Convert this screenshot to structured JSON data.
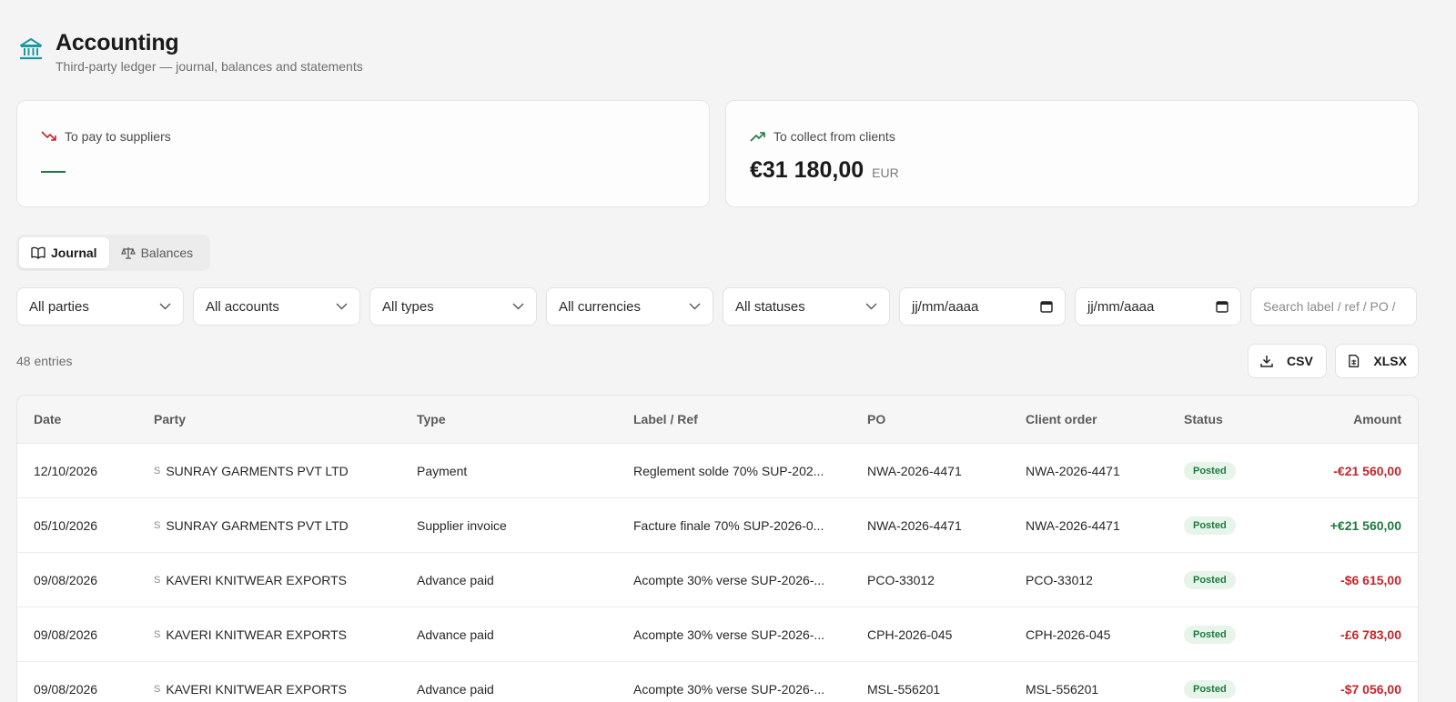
{
  "header": {
    "title": "Accounting",
    "subtitle": "Third-party ledger — journal, balances and statements"
  },
  "cards": {
    "pay": {
      "label": "To pay to suppliers",
      "value": ""
    },
    "collect": {
      "label": "To collect from clients",
      "amount": "€31 180,00",
      "currency": "EUR"
    }
  },
  "tabs": [
    {
      "label": "Journal",
      "active": true
    },
    {
      "label": "Balances",
      "active": false
    }
  ],
  "filters": {
    "parties": "All parties",
    "accounts": "All accounts",
    "types": "All types",
    "currencies": "All currencies",
    "statuses": "All statuses",
    "date_from": "jj/mm/aaaa",
    "date_to": "jj/mm/aaaa",
    "search_placeholder": "Search label / ref / PO /"
  },
  "entries_count": "48 entries",
  "export": {
    "csv": "CSV",
    "xlsx": "XLSX"
  },
  "table": {
    "headers": {
      "date": "Date",
      "party": "Party",
      "type": "Type",
      "label": "Label / Ref",
      "po": "PO",
      "client_order": "Client order",
      "status": "Status",
      "amount": "Amount"
    },
    "rows": [
      {
        "date": "12/10/2026",
        "party_prefix": "S",
        "party": "SUNRAY GARMENTS PVT LTD",
        "type": "Payment",
        "label": "Reglement solde 70% SUP-202...",
        "po": "NWA-2026-4471",
        "client_order": "NWA-2026-4471",
        "status": "Posted",
        "amount": "-€21 560,00"
      },
      {
        "date": "05/10/2026",
        "party_prefix": "S",
        "party": "SUNRAY GARMENTS PVT LTD",
        "type": "Supplier invoice",
        "label": "Facture finale 70% SUP-2026-0...",
        "po": "NWA-2026-4471",
        "client_order": "NWA-2026-4471",
        "status": "Posted",
        "amount": "+€21 560,00"
      },
      {
        "date": "09/08/2026",
        "party_prefix": "S",
        "party": "KAVERI KNITWEAR EXPORTS",
        "type": "Advance paid",
        "label": "Acompte 30% verse SUP-2026-...",
        "po": "PCO-33012",
        "client_order": "PCO-33012",
        "status": "Posted",
        "amount": "-$6 615,00"
      },
      {
        "date": "09/08/2026",
        "party_prefix": "S",
        "party": "KAVERI KNITWEAR EXPORTS",
        "type": "Advance paid",
        "label": "Acompte 30% verse SUP-2026-...",
        "po": "CPH-2026-045",
        "client_order": "CPH-2026-045",
        "status": "Posted",
        "amount": "-£6 783,00"
      },
      {
        "date": "09/08/2026",
        "party_prefix": "S",
        "party": "KAVERI KNITWEAR EXPORTS",
        "type": "Advance paid",
        "label": "Acompte 30% verse SUP-2026-...",
        "po": "MSL-556201",
        "client_order": "MSL-556201",
        "status": "Posted",
        "amount": "-$7 056,00"
      }
    ]
  },
  "colors": {
    "accent": "#1a9aa0",
    "negative": "#c4252a",
    "positive": "#1e7a3f",
    "posted_bg": "#e6f4ea"
  }
}
